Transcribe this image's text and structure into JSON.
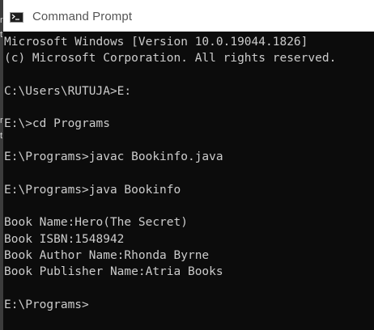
{
  "window": {
    "title": "Command Prompt",
    "icon": "terminal-icon"
  },
  "console": {
    "lines": [
      "Microsoft Windows [Version 10.0.19044.1826]",
      "(c) Microsoft Corporation. All rights reserved.",
      "",
      "C:\\Users\\RUTUJA>E:",
      "",
      "E:\\>cd Programs",
      "",
      "E:\\Programs>javac Bookinfo.java",
      "",
      "E:\\Programs>java Bookinfo",
      "",
      "Book Name:Hero(The Secret)",
      "Book ISBN:1548942",
      "Book Author Name:Rhonda Byrne",
      "Book Publisher Name:Atria Books",
      "",
      "E:\\Programs>"
    ]
  },
  "colors": {
    "console_bg": "#0c0c0c",
    "console_text": "#cccccc",
    "titlebar_bg": "#ffffff",
    "title_text": "#555555"
  }
}
